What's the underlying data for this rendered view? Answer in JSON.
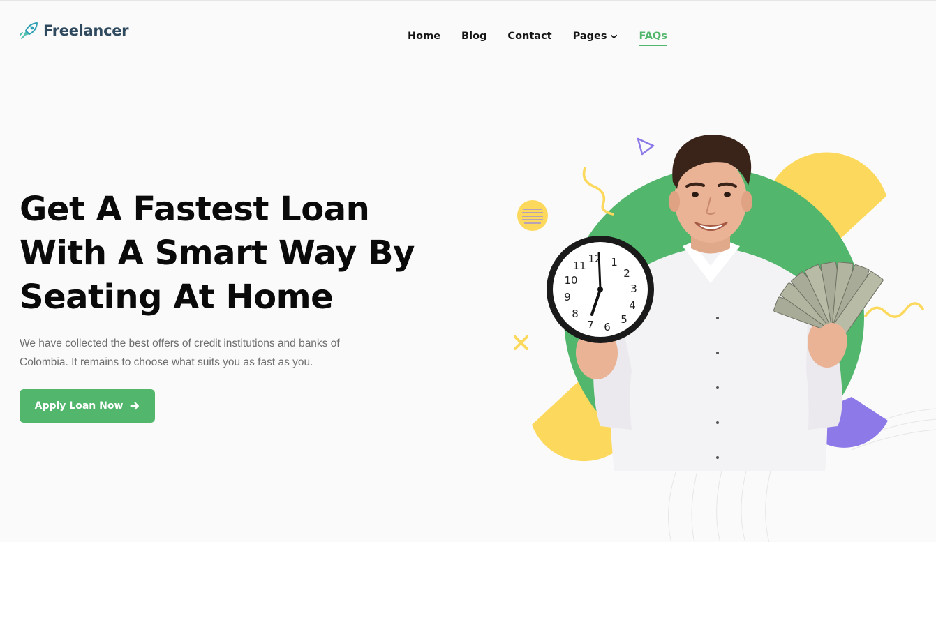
{
  "brand": {
    "name": "Freelancer",
    "logo_icon": "rocket-icon"
  },
  "nav": {
    "items": [
      {
        "label": "Home",
        "active": false
      },
      {
        "label": "Blog",
        "active": false
      },
      {
        "label": "Contact",
        "active": false
      },
      {
        "label": "Pages",
        "active": false,
        "has_dropdown": true
      },
      {
        "label": "FAQs",
        "active": true
      }
    ]
  },
  "hero": {
    "headline_lines": [
      "Get A Fastest Loan",
      "With A Smart Way By",
      "Seating At Home"
    ],
    "subtext": "We have collected the best offers of credit institutions and banks of Colombia. It remains to choose what suits you as fast as you.",
    "cta_label": "Apply Loan Now",
    "cta_icon": "arrow-right-icon",
    "illustration": "man-holding-clock-and-money"
  },
  "colors": {
    "accent_green": "#52b76c",
    "yellow": "#fcd95c",
    "purple": "#8e79e9",
    "heading": "#0a0a0a",
    "body_text": "#6e6e6e",
    "hero_bg": "#fafafa"
  }
}
